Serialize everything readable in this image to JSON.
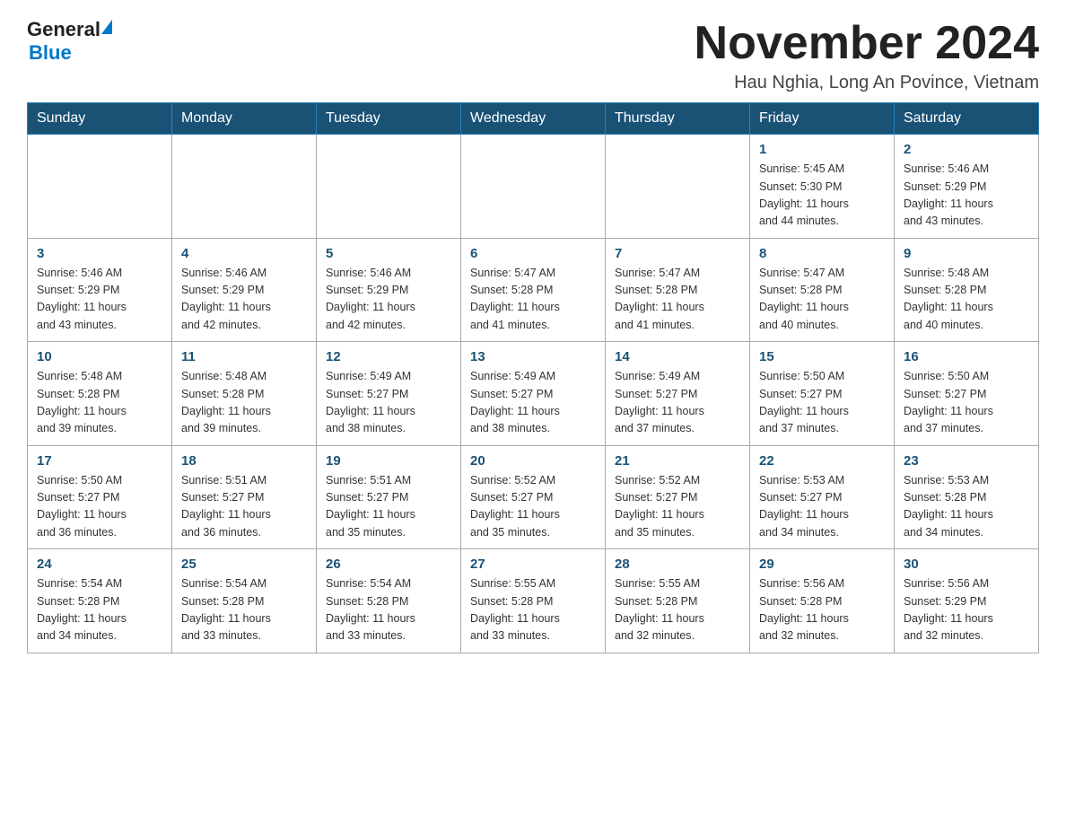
{
  "header": {
    "logo_general": "General",
    "logo_blue": "Blue",
    "month_title": "November 2024",
    "location": "Hau Nghia, Long An Povince, Vietnam"
  },
  "days_of_week": [
    "Sunday",
    "Monday",
    "Tuesday",
    "Wednesday",
    "Thursday",
    "Friday",
    "Saturday"
  ],
  "weeks": [
    [
      {
        "day": "",
        "info": ""
      },
      {
        "day": "",
        "info": ""
      },
      {
        "day": "",
        "info": ""
      },
      {
        "day": "",
        "info": ""
      },
      {
        "day": "",
        "info": ""
      },
      {
        "day": "1",
        "info": "Sunrise: 5:45 AM\nSunset: 5:30 PM\nDaylight: 11 hours\nand 44 minutes."
      },
      {
        "day": "2",
        "info": "Sunrise: 5:46 AM\nSunset: 5:29 PM\nDaylight: 11 hours\nand 43 minutes."
      }
    ],
    [
      {
        "day": "3",
        "info": "Sunrise: 5:46 AM\nSunset: 5:29 PM\nDaylight: 11 hours\nand 43 minutes."
      },
      {
        "day": "4",
        "info": "Sunrise: 5:46 AM\nSunset: 5:29 PM\nDaylight: 11 hours\nand 42 minutes."
      },
      {
        "day": "5",
        "info": "Sunrise: 5:46 AM\nSunset: 5:29 PM\nDaylight: 11 hours\nand 42 minutes."
      },
      {
        "day": "6",
        "info": "Sunrise: 5:47 AM\nSunset: 5:28 PM\nDaylight: 11 hours\nand 41 minutes."
      },
      {
        "day": "7",
        "info": "Sunrise: 5:47 AM\nSunset: 5:28 PM\nDaylight: 11 hours\nand 41 minutes."
      },
      {
        "day": "8",
        "info": "Sunrise: 5:47 AM\nSunset: 5:28 PM\nDaylight: 11 hours\nand 40 minutes."
      },
      {
        "day": "9",
        "info": "Sunrise: 5:48 AM\nSunset: 5:28 PM\nDaylight: 11 hours\nand 40 minutes."
      }
    ],
    [
      {
        "day": "10",
        "info": "Sunrise: 5:48 AM\nSunset: 5:28 PM\nDaylight: 11 hours\nand 39 minutes."
      },
      {
        "day": "11",
        "info": "Sunrise: 5:48 AM\nSunset: 5:28 PM\nDaylight: 11 hours\nand 39 minutes."
      },
      {
        "day": "12",
        "info": "Sunrise: 5:49 AM\nSunset: 5:27 PM\nDaylight: 11 hours\nand 38 minutes."
      },
      {
        "day": "13",
        "info": "Sunrise: 5:49 AM\nSunset: 5:27 PM\nDaylight: 11 hours\nand 38 minutes."
      },
      {
        "day": "14",
        "info": "Sunrise: 5:49 AM\nSunset: 5:27 PM\nDaylight: 11 hours\nand 37 minutes."
      },
      {
        "day": "15",
        "info": "Sunrise: 5:50 AM\nSunset: 5:27 PM\nDaylight: 11 hours\nand 37 minutes."
      },
      {
        "day": "16",
        "info": "Sunrise: 5:50 AM\nSunset: 5:27 PM\nDaylight: 11 hours\nand 37 minutes."
      }
    ],
    [
      {
        "day": "17",
        "info": "Sunrise: 5:50 AM\nSunset: 5:27 PM\nDaylight: 11 hours\nand 36 minutes."
      },
      {
        "day": "18",
        "info": "Sunrise: 5:51 AM\nSunset: 5:27 PM\nDaylight: 11 hours\nand 36 minutes."
      },
      {
        "day": "19",
        "info": "Sunrise: 5:51 AM\nSunset: 5:27 PM\nDaylight: 11 hours\nand 35 minutes."
      },
      {
        "day": "20",
        "info": "Sunrise: 5:52 AM\nSunset: 5:27 PM\nDaylight: 11 hours\nand 35 minutes."
      },
      {
        "day": "21",
        "info": "Sunrise: 5:52 AM\nSunset: 5:27 PM\nDaylight: 11 hours\nand 35 minutes."
      },
      {
        "day": "22",
        "info": "Sunrise: 5:53 AM\nSunset: 5:27 PM\nDaylight: 11 hours\nand 34 minutes."
      },
      {
        "day": "23",
        "info": "Sunrise: 5:53 AM\nSunset: 5:28 PM\nDaylight: 11 hours\nand 34 minutes."
      }
    ],
    [
      {
        "day": "24",
        "info": "Sunrise: 5:54 AM\nSunset: 5:28 PM\nDaylight: 11 hours\nand 34 minutes."
      },
      {
        "day": "25",
        "info": "Sunrise: 5:54 AM\nSunset: 5:28 PM\nDaylight: 11 hours\nand 33 minutes."
      },
      {
        "day": "26",
        "info": "Sunrise: 5:54 AM\nSunset: 5:28 PM\nDaylight: 11 hours\nand 33 minutes."
      },
      {
        "day": "27",
        "info": "Sunrise: 5:55 AM\nSunset: 5:28 PM\nDaylight: 11 hours\nand 33 minutes."
      },
      {
        "day": "28",
        "info": "Sunrise: 5:55 AM\nSunset: 5:28 PM\nDaylight: 11 hours\nand 32 minutes."
      },
      {
        "day": "29",
        "info": "Sunrise: 5:56 AM\nSunset: 5:28 PM\nDaylight: 11 hours\nand 32 minutes."
      },
      {
        "day": "30",
        "info": "Sunrise: 5:56 AM\nSunset: 5:29 PM\nDaylight: 11 hours\nand 32 minutes."
      }
    ]
  ]
}
